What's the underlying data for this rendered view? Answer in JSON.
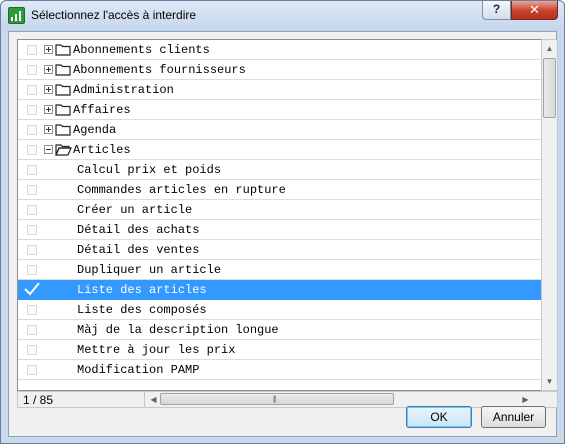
{
  "window": {
    "title": "Sélectionnez l'accès à interdire",
    "help_label": "?",
    "close_label": "✕"
  },
  "tree": {
    "rows": [
      {
        "label": "Abonnements clients",
        "type": "folder",
        "expanded": false,
        "checked": false
      },
      {
        "label": "Abonnements fournisseurs",
        "type": "folder",
        "expanded": false,
        "checked": false
      },
      {
        "label": "Administration",
        "type": "folder",
        "expanded": false,
        "checked": false
      },
      {
        "label": "Affaires",
        "type": "folder",
        "expanded": false,
        "checked": false
      },
      {
        "label": "Agenda",
        "type": "folder",
        "expanded": false,
        "checked": false
      },
      {
        "label": "Articles",
        "type": "folder",
        "expanded": true,
        "checked": false
      },
      {
        "label": "Calcul prix et poids",
        "type": "item",
        "checked": false
      },
      {
        "label": "Commandes articles en rupture",
        "type": "item",
        "checked": false
      },
      {
        "label": "Créer un article",
        "type": "item",
        "checked": false
      },
      {
        "label": "Détail des achats",
        "type": "item",
        "checked": false
      },
      {
        "label": "Détail des ventes",
        "type": "item",
        "checked": false
      },
      {
        "label": "Dupliquer un article",
        "type": "item",
        "checked": false
      },
      {
        "label": "Liste des articles",
        "type": "item",
        "checked": true,
        "selected": true
      },
      {
        "label": "Liste des composés",
        "type": "item",
        "checked": false
      },
      {
        "label": "Màj de la description longue",
        "type": "item",
        "checked": false
      },
      {
        "label": "Mettre à jour les prix",
        "type": "item",
        "checked": false
      },
      {
        "label": "Modification PAMP",
        "type": "item",
        "checked": false
      }
    ]
  },
  "status": {
    "counter": "1 / 85"
  },
  "buttons": {
    "ok_label": "OK",
    "cancel_label": "Annuler"
  },
  "colors": {
    "selection": "#3399ff",
    "close_button": "#c7402d",
    "title_bar": "#c4d5ea"
  }
}
